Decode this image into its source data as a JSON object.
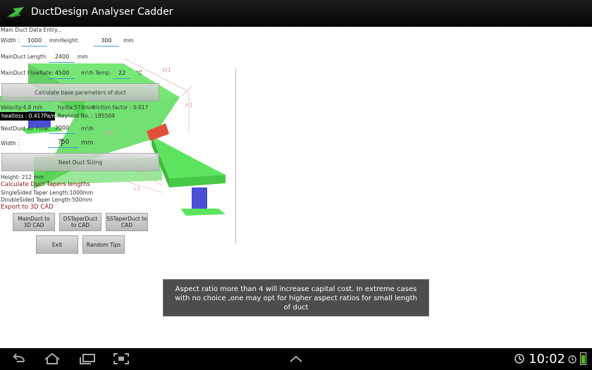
{
  "app": {
    "title": "DuctDesign Analyser Cadder"
  },
  "form": {
    "main_entry_label": "Main Duct Data Entry...",
    "width_label": "Width :",
    "width_value": "1000",
    "width_unit": "mm",
    "height_label": "Height:",
    "height_value": "300",
    "height_unit": "mm",
    "length_label": "MainDuct Length:",
    "length_value": "2400",
    "length_unit": "mm",
    "flowrate_label": "MainDuct FlowRate:",
    "flowrate_value": "4500",
    "flowrate_unit": "m³/h",
    "temp_label": "Temp.",
    "temp_value": "22",
    "temp_unit": "°C",
    "calc_button": "Calculate base parameters of duct",
    "velocity": "Velocity:4.8 m/s",
    "hydia": "hydia:574mm",
    "friction": "friction factor : 0.017",
    "heatloss": "heatloss : 0.417Pa/m",
    "reynold": "Reynold No. : 185504",
    "next_airflow_label": "NextDuct Air Flow:",
    "next_airflow_value": "2000",
    "next_airflow_unit": "m³/h",
    "next_width_label": "Width :",
    "next_width_value": "750",
    "next_width_unit": "mm",
    "next_sizing_button": "Next Duct Sizing",
    "result_height": "Height: 212 mm",
    "tapers_title": "Calculate Duct Tapers lengths",
    "single_taper": "SingleSided Taper Length:1000mm",
    "double_taper": "DoubleSided Taper Length:500mm",
    "export_title": "Export to 3D CAD"
  },
  "buttons": {
    "main_duct": "MainDuct to 3D CAD",
    "ds_taper": "DSTaperDuct to CAD",
    "ss_taper": "SSTaperDuct to CAD",
    "exit": "Exit",
    "tips": "Random Tips"
  },
  "drawing": {
    "label_w1": "W1",
    "label_h1": "H1",
    "label_w2": "W2",
    "label_l1": "L1"
  },
  "toast": {
    "message": "Aspect ratio more than 4 will increase capital cost. In extreme cases with  no choice ,one may opt for higher aspect ratios for small length of duct"
  },
  "statusbar": {
    "time": "10:02"
  },
  "colors": {
    "duct_green": "#4fd84f",
    "duct_blue": "#4a4fd6",
    "duct_red": "#e0503a",
    "section_red": "#8b1a1a",
    "battery": "#4fc300"
  },
  "icons": [
    "back-icon",
    "home-icon",
    "recent-apps-icon",
    "screenshot-icon",
    "up-chevron-icon",
    "sync-icon",
    "alarm-icon",
    "battery-icon"
  ]
}
